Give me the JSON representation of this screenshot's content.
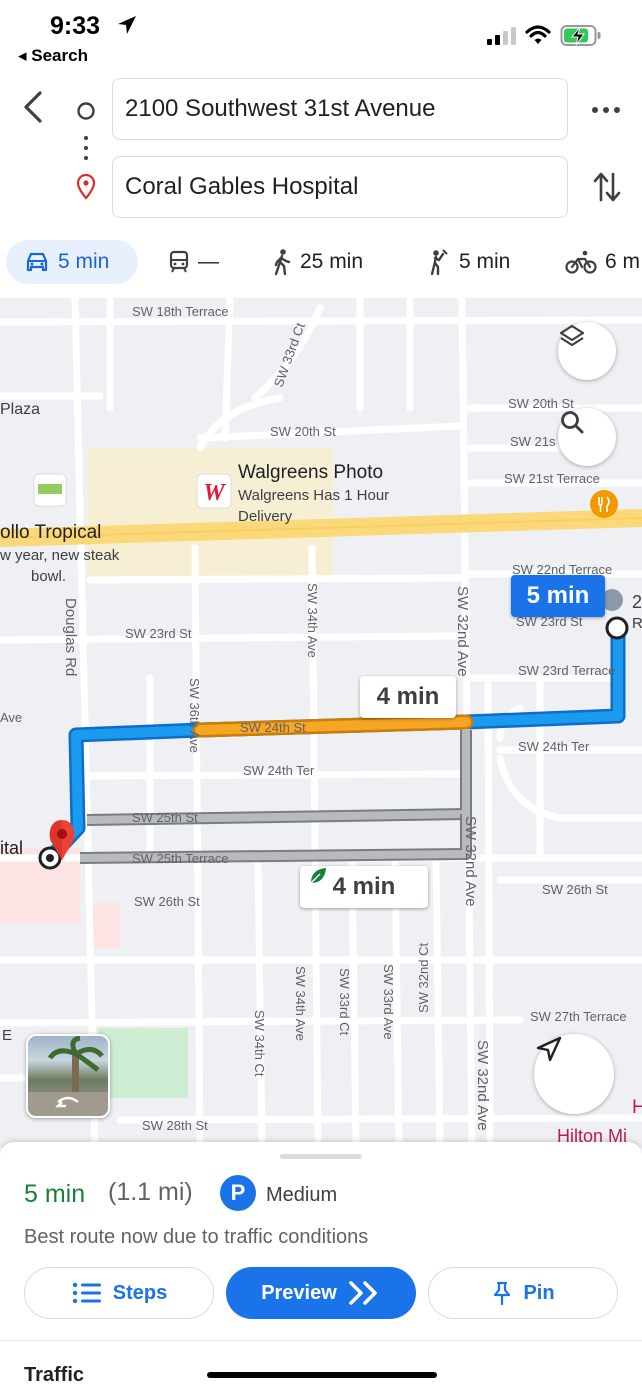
{
  "status": {
    "time": "9:33",
    "back_app": "◂ Search"
  },
  "directions": {
    "origin": "2100 Southwest 31st Avenue",
    "destination": "Coral Gables Hospital"
  },
  "modes": [
    {
      "icon": "car-icon",
      "label": "5 min"
    },
    {
      "icon": "transit-icon",
      "label": "—"
    },
    {
      "icon": "walk-icon",
      "label": "25 min"
    },
    {
      "icon": "rideshare-icon",
      "label": "5 min"
    },
    {
      "icon": "bike-icon",
      "label": "6 m"
    }
  ],
  "map": {
    "streets": {
      "sw_18th_terrace": "SW 18th Terrace",
      "sw_33rd_ct_top": "SW 33rd Ct",
      "plaza": "Plaza",
      "sw_20th_st_mid": "SW 20th St",
      "sw_20th_st_right": "SW 20th St",
      "sw_21s": "SW 21s",
      "sw_21st_terrace": "SW 21st Terrace",
      "sw_22nd_terrace": "SW 22nd Terrace",
      "sw_23rd_st_right": "SW 23rd St",
      "sw_23rd_st_left": "SW 23rd St",
      "sw_23rd_terrace": "SW 23rd Terrace",
      "douglas_rd": "Douglas Rd",
      "sw_34th_ave_top": "SW 34th Ave",
      "sw_36th_ave": "SW 36th Ave",
      "sw_32nd_ave_top": "SW 32nd Ave",
      "ave_left": "Ave",
      "sw_24th_st": "SW 24th St",
      "sw_24th_ter_mid": "SW 24th Ter",
      "sw_24th_ter_right": "SW 24th Ter",
      "sw_25th_st": "SW 25th St",
      "sw_25th_terrace": "SW 25th Terrace",
      "sw_32nd_ave_mid": "SW 32nd Ave",
      "sw_26th_st_left": "SW 26th St",
      "sw_26th_st_right": "SW 26th St",
      "sw_27th_terrace": "SW 27th Terrace",
      "sw_34th_ct": "SW 34th Ct",
      "sw_34th_ave_bottom": "SW 34th Ave",
      "sw_33rd_ct_bottom": "SW 33rd Ct",
      "sw_33rd_ave": "SW 33rd Ave",
      "sw_32nd_ct": "SW 32nd Ct",
      "sw_32nd_ave_bottom": "SW 32nd Ave",
      "sw_28th_st": "SW 28th St",
      "e_left": "E",
      "r_right": "R",
      "two_right": "2"
    },
    "pois": {
      "walgreens_title": "Walgreens Photo",
      "walgreens_sub1": "Walgreens Has 1 Hour",
      "walgreens_sub2": "Delivery",
      "pollo_title": "ollo Tropical",
      "pollo_sub1": "w year, new steak",
      "pollo_sub2": "bowl.",
      "hospital_label": "ital",
      "hilton": "Hilton Mi",
      "hilton_h": "H"
    },
    "callouts": {
      "primary": "5 min",
      "alt1": "4 min",
      "alt2": "4 min"
    },
    "colors": {
      "route": "#1a9bf0",
      "traffic": "#f6a623",
      "alt_route": "#a8abaf",
      "main_road": "#fbd87a"
    }
  },
  "sheet": {
    "duration": "5 min",
    "distance": "(1.1 mi)",
    "parking_letter": "P",
    "parking_level": "Medium",
    "description": "Best route now due to traffic conditions",
    "steps_label": "Steps",
    "preview_label": "Preview",
    "pin_label": "Pin",
    "traffic_label": "Traffic"
  }
}
